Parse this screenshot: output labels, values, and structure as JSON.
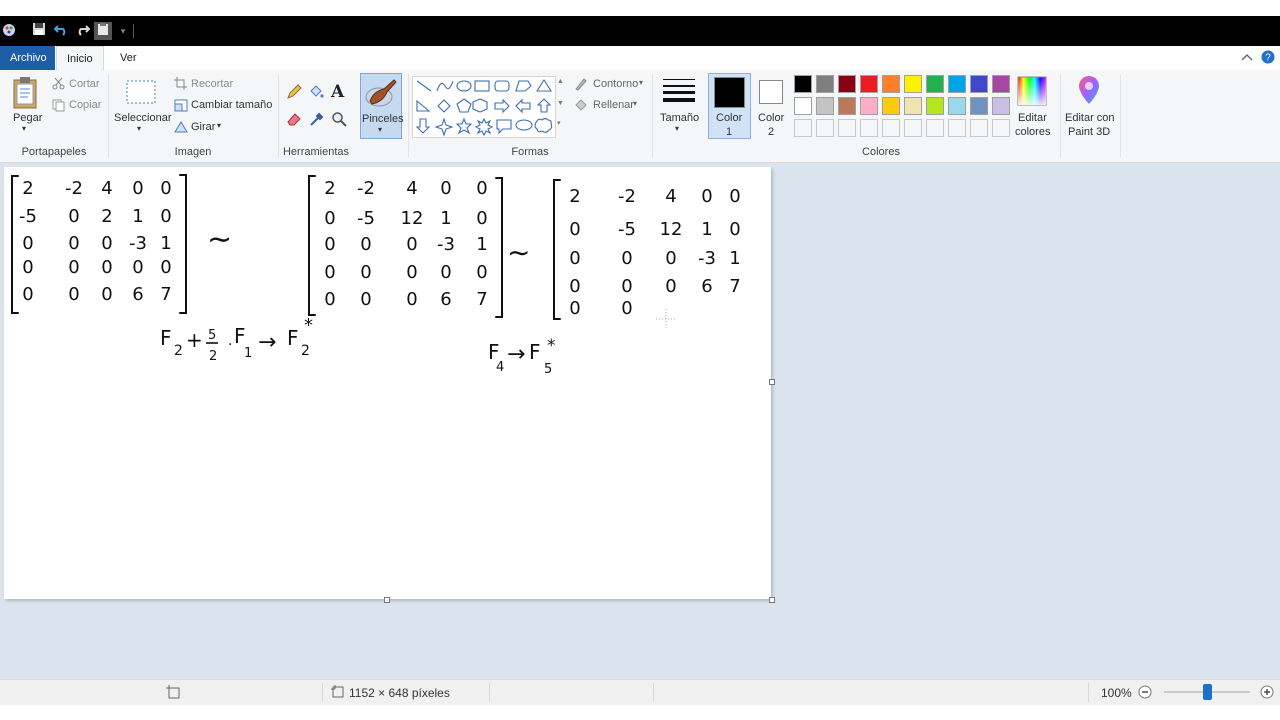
{
  "app": {
    "title": ""
  },
  "tabs": {
    "file": "Archivo",
    "home": "Inicio",
    "view": "Ver"
  },
  "clipboard": {
    "paste": "Pegar",
    "cut": "Cortar",
    "copy": "Copiar",
    "label": "Portapapeles"
  },
  "image": {
    "select": "Seleccionar",
    "crop": "Recortar",
    "resize": "Cambiar tamaño",
    "rotate": "Girar",
    "label": "Imagen"
  },
  "tools": {
    "label": "Herramientas"
  },
  "brushes": {
    "label": "Pinceles"
  },
  "shapes": {
    "outline": "Contorno",
    "fill": "Rellenar",
    "label": "Formas"
  },
  "size": {
    "label": "Tamaño"
  },
  "colors": {
    "color1": "Color",
    "color1_num": "1",
    "color2": "Color",
    "color2_num": "2",
    "edit_line1": "Editar",
    "edit_line2": "colores",
    "label": "Colores",
    "color1_value": "#000000",
    "color2_value": "#ffffff",
    "palette_row1": [
      "#000000",
      "#7f7f7f",
      "#880015",
      "#ed1c24",
      "#ff7f27",
      "#fff200",
      "#22b14c",
      "#00a2e8",
      "#3f48cc",
      "#a349a4"
    ],
    "palette_row2": [
      "#ffffff",
      "#c3c3c3",
      "#b97a57",
      "#ffaec9",
      "#ffc90e",
      "#efe4b0",
      "#b5e61d",
      "#99d9ea",
      "#7092be",
      "#c8bfe7"
    ]
  },
  "paint3d": {
    "line1": "Editar con",
    "line2": "Paint 3D"
  },
  "canvas_content": {
    "matrix1": [
      [
        "2",
        "-2",
        "4",
        "0",
        "0"
      ],
      [
        "-5",
        "0",
        "2",
        "1",
        "0"
      ],
      [
        "0",
        "0",
        "0",
        "-3",
        "1"
      ],
      [
        "0",
        "0",
        "0",
        "0",
        "0"
      ],
      [
        "0",
        "0",
        "0",
        "6",
        "7"
      ]
    ],
    "matrix2": [
      [
        "2",
        "-2",
        "4",
        "0",
        "0"
      ],
      [
        "0",
        "-5",
        "12",
        "1",
        "0"
      ],
      [
        "0",
        "0",
        "0",
        "-3",
        "1"
      ],
      [
        "0",
        "0",
        "0",
        "0",
        "0"
      ],
      [
        "0",
        "0",
        "0",
        "6",
        "7"
      ]
    ],
    "matrix3": [
      [
        "2",
        "-2",
        "4",
        "0",
        "0"
      ],
      [
        "0",
        "-5",
        "12",
        "1",
        "0"
      ],
      [
        "0",
        "0",
        "0",
        "-3",
        "1"
      ],
      [
        "0",
        "0",
        "0",
        "6",
        "7"
      ],
      [
        "0",
        "0",
        "",
        "",
        ""
      ]
    ],
    "tilde": "∼",
    "op1": {
      "f": "F",
      "sub2": "2",
      "plus": "+",
      "frac_num": "5",
      "frac_den": "2",
      "dot": "·",
      "sub1": "1",
      "arrow": "→",
      "star": "*"
    },
    "op2": {
      "f": "F",
      "sub4": "4",
      "arrow": "→",
      "sub5": "5",
      "star": "*"
    }
  },
  "status": {
    "dimensions": "1152 × 648 píxeles",
    "zoom": "100%"
  }
}
